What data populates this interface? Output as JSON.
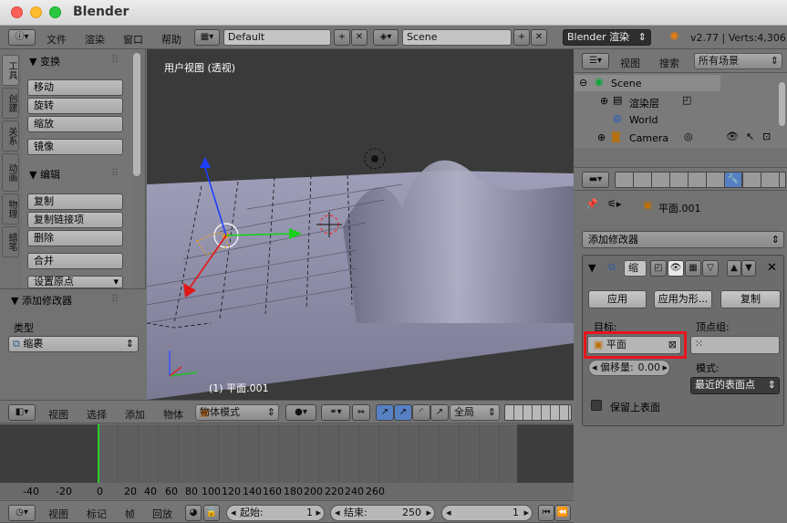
{
  "window": {
    "title": "Blender"
  },
  "info_header": {
    "menus": [
      "文件",
      "渲染",
      "窗口",
      "帮助"
    ],
    "layout": "Default",
    "scene": "Scene",
    "engine": "Blender 渲染",
    "version_stats": "v2.77 | Verts:4,306"
  },
  "tool_shelf": {
    "tabs": [
      "工具",
      "创建",
      "关系",
      "动画",
      "物理",
      "蜡笔"
    ],
    "transform": {
      "title": "▼ 变换",
      "buttons": [
        "移动",
        "旋转",
        "缩放",
        "镜像"
      ]
    },
    "edit": {
      "title": "▼ 编辑",
      "buttons": [
        "复制",
        "复制链接项",
        "删除",
        "合并",
        "设置原点"
      ]
    },
    "operator": {
      "title": "▼ 添加修改器",
      "type_label": "类型",
      "type_value": "缩裹"
    }
  },
  "viewport": {
    "label": "用户视图 (透视)",
    "object_label": "(1) 平面.001"
  },
  "view3d_header": {
    "menus": [
      "视图",
      "选择",
      "添加",
      "物体"
    ],
    "mode": "物体模式",
    "orientation": "全局"
  },
  "timeline": {
    "ticks": [
      "-40",
      "-20",
      "0",
      "20",
      "40",
      "60",
      "80",
      "100",
      "120",
      "140",
      "160",
      "180",
      "200",
      "220",
      "240",
      "260"
    ],
    "menus": [
      "视图",
      "标记",
      "帧",
      "回放"
    ],
    "start_label": "起始:",
    "start_value": "1",
    "end_label": "结束:",
    "end_value": "250",
    "current": "1"
  },
  "outliner": {
    "menus": [
      "视图",
      "搜索"
    ],
    "filter": "所有场景",
    "items": [
      "Scene",
      "渲染层",
      "World",
      "Camera"
    ]
  },
  "properties": {
    "object_name": "平面.001",
    "add_modifier": "添加修改器",
    "modifier_name": "缩",
    "apply": "应用",
    "apply_as_shape": "应用为形...",
    "copy": "复制",
    "target_label": "目标:",
    "target_value": "平面",
    "vgroup_label": "顶点组:",
    "offset_label": "偏移量:",
    "offset_value": "0.00",
    "mode_label": "模式:",
    "mode_value": "最近的表面点",
    "keep_above": "保留上表面"
  },
  "colors": {
    "highlight": "#e8141c",
    "viewport_bg": "#393939",
    "mesh": "#8c8ca6"
  }
}
